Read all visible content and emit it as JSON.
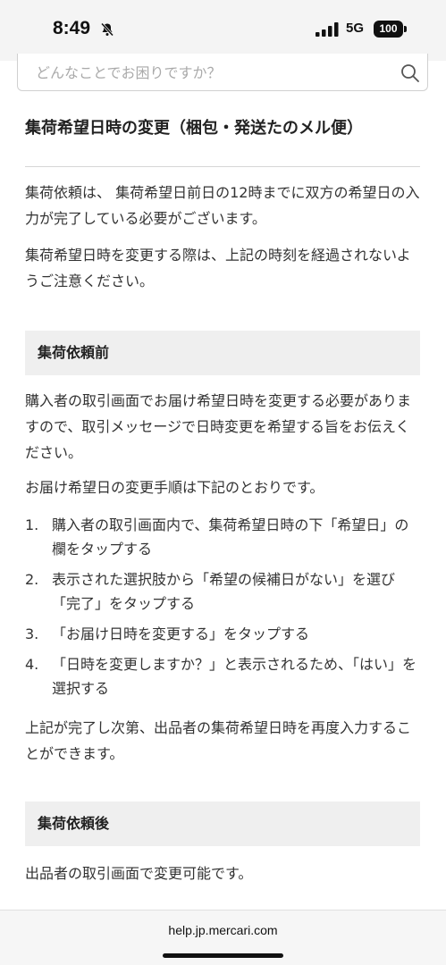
{
  "status_bar": {
    "time": "8:49",
    "network": "5G",
    "battery": "100"
  },
  "search": {
    "placeholder": "どんなことでお困りですか？"
  },
  "article": {
    "title": "集荷希望日時の変更（梱包・発送たのメル便）",
    "intro_1": "集荷依頼は、 集荷希望日前日の12時までに双方の希望日の入力が完了している必要がございます。",
    "intro_2": "集荷希望日時を変更する際は、上記の時刻を経過されないようご注意ください。",
    "section_before": {
      "heading": "集荷依頼前",
      "para_1": "購入者の取引画面でお届け希望日時を変更する必要がありますので、取引メッセージで日時変更を希望する旨をお伝えください。",
      "para_2": "お届け希望日の変更手順は下記のとおりです。",
      "steps": [
        {
          "num": "1.",
          "text": "購入者の取引画面内で、集荷希望日時の下「希望日」の欄をタップする"
        },
        {
          "num": "2.",
          "text": "表示された選択肢から「希望の候補日がない」を選び「完了」をタップする"
        },
        {
          "num": "3.",
          "text": "「お届け日時を変更する」をタップする"
        },
        {
          "num": "4.",
          "text": "「日時を変更しますか？」と表示されるため、「はい」を選択する"
        }
      ],
      "para_3": "上記が完了し次第、出品者の集荷希望日時を再度入力することができます。"
    },
    "section_after": {
      "heading": "集荷依頼後",
      "para_1": "出品者の取引画面で変更可能です。"
    }
  },
  "browser": {
    "url": "help.jp.mercari.com"
  }
}
